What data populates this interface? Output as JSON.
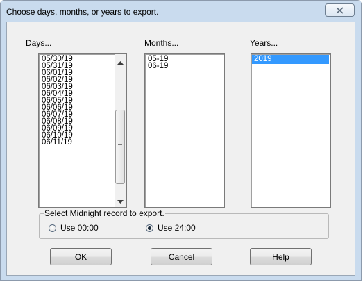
{
  "window": {
    "title": "Choose days, months, or years to export."
  },
  "days": {
    "label": "Days...",
    "items": [
      "05/30/19",
      "05/31/19",
      "06/01/19",
      "06/02/19",
      "06/03/19",
      "06/04/19",
      "06/05/19",
      "06/06/19",
      "06/07/19",
      "06/08/19",
      "06/09/19",
      "06/10/19",
      "06/11/19"
    ]
  },
  "months": {
    "label": "Months...",
    "items": [
      "05-19",
      "06-19"
    ]
  },
  "years": {
    "label": "Years...",
    "items": [
      "2019"
    ],
    "selected": "2019"
  },
  "midnight": {
    "legend": "Select Midnight record to export.",
    "option_0000": "Use 00:00",
    "option_2400": "Use 24:00",
    "selected": "Use 24:00"
  },
  "buttons": {
    "ok": "OK",
    "cancel": "Cancel",
    "help": "Help"
  },
  "colors": {
    "selection": "#3399ff",
    "frame": "#c9dbee"
  }
}
